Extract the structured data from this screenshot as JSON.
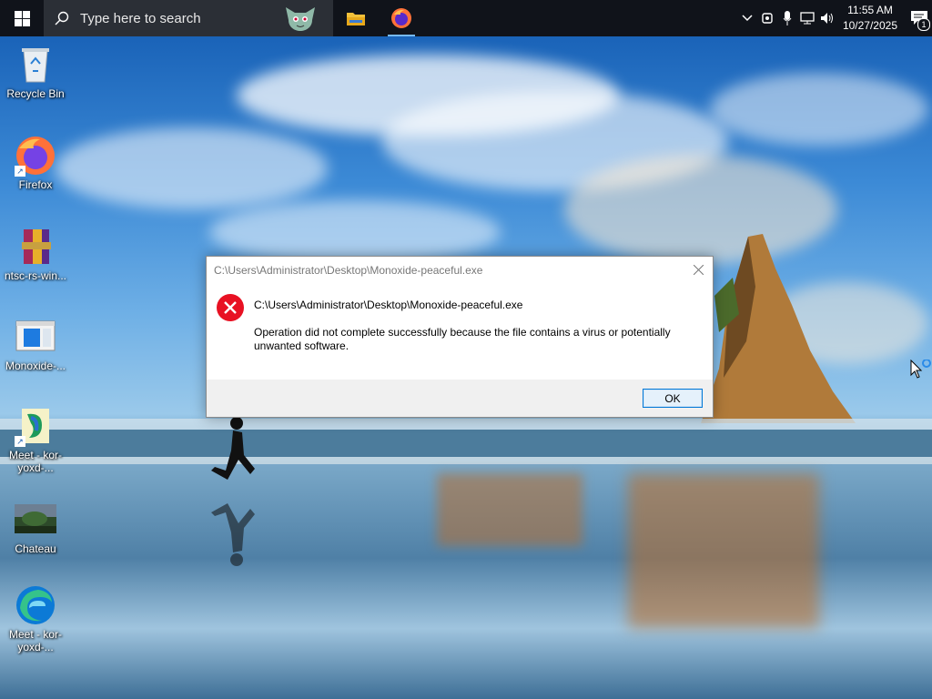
{
  "taskbar": {
    "search_placeholder": "Type here to search",
    "apps": [
      {
        "name": "File Explorer",
        "icon": "folder-icon"
      },
      {
        "name": "Firefox",
        "icon": "firefox-icon"
      }
    ],
    "clock": {
      "time": "11:55 AM",
      "date": "10/27/2025"
    },
    "notification_count": "1"
  },
  "desktop": {
    "icons": [
      {
        "label": "Recycle Bin",
        "icon": "recycle-bin-icon"
      },
      {
        "label": "Firefox",
        "icon": "firefox-icon"
      },
      {
        "label": "ntsc-rs-win...",
        "icon": "winrar-archive-icon"
      },
      {
        "label": "Monoxide-...",
        "icon": "app-window-icon"
      },
      {
        "label": "Meet - kor-yoxd-...",
        "icon": "meet-shortcut-icon"
      },
      {
        "label": "Chateau",
        "icon": "image-thumbnail-icon"
      },
      {
        "label": "Meet - kor-yoxd-...",
        "icon": "edge-icon"
      }
    ]
  },
  "dialog": {
    "title": "C:\\Users\\Administrator\\Desktop\\Monoxide-peaceful.exe",
    "path": "C:\\Users\\Administrator\\Desktop\\Monoxide-peaceful.exe",
    "message": "Operation did not complete successfully because the file contains a virus or potentially unwanted software.",
    "ok_label": "OK"
  },
  "colors": {
    "taskbar_bg": "#10131a",
    "search_bg": "#2b2f36",
    "error_red": "#e81123",
    "button_border": "#0078d7"
  }
}
